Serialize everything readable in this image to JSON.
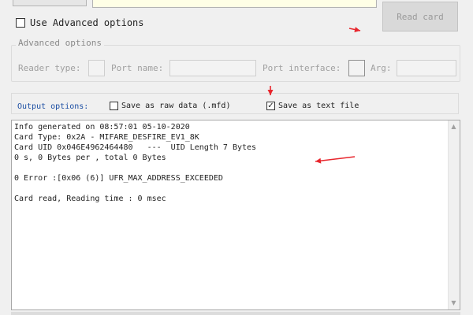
{
  "top": {
    "read_card_label": "Read card",
    "use_advanced_label": "Use Advanced options"
  },
  "advanced": {
    "title": "Advanced options",
    "reader_type_label": "Reader type:",
    "port_name_label": "Port name:",
    "port_interface_label": "Port interface:",
    "arg_label": "Arg:"
  },
  "output_options": {
    "label": "Output options:",
    "raw_label": "Save as raw data (.mfd)",
    "raw_checked": false,
    "text_label": "Save as text file",
    "text_checked": true
  },
  "output_text": {
    "lines": [
      "Info generated on 08:57:01 05-10-2020",
      "Card Type: 0x2A - MIFARE_DESFIRE_EV1_8K",
      "Card UID 0x046E4962464480   ---  UID Length 7 Bytes",
      "0 s, 0 Bytes per , total 0 Bytes",
      "",
      "0 Error :[0x06 (6)] UFR_MAX_ADDRESS_EXCEEDED",
      "",
      "Card read, Reading time : 0 msec"
    ]
  },
  "colors": {
    "annotation_arrow": "#e8262d",
    "output_label": "#1d4fa3"
  },
  "icons": {
    "scroll_up": "scroll-up-arrow-icon",
    "scroll_down": "scroll-down-arrow-icon"
  }
}
